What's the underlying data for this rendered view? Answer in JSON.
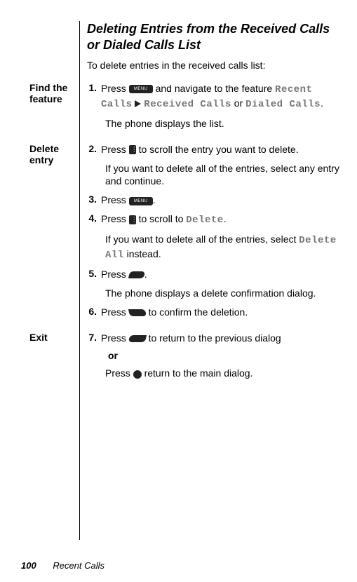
{
  "title": "Deleting Entries from the Received Calls or Dialed Calls List",
  "intro": "To delete entries in the received calls list:",
  "groups": {
    "find": {
      "label": "Find the feature",
      "step1_num": "1.",
      "step1_a": "Press ",
      "step1_b": " and navigate to the feature ",
      "code_recent": "Recent Calls",
      "code_recv": "Received Calls",
      "code_or": " or ",
      "code_dial": "Dialed Calls",
      "step1_tail": ".",
      "step1_follow": "The phone displays the list."
    },
    "del": {
      "label": "Delete entry",
      "step2_num": "2.",
      "step2_a": "Press ",
      "step2_b": " to scroll the entry you want to delete.",
      "step2_follow": "If you want to delete all of the entries, select any entry and continue.",
      "step3_num": "3.",
      "step3_a": "Press ",
      "step3_tail": ".",
      "step4_num": "4.",
      "step4_a": "Press ",
      "step4_b": " to scroll to ",
      "code_delete": "Delete",
      "step4_tail": ".",
      "step4_follow_a": "If you want to delete all of the entries, select ",
      "code_delall": "Delete All",
      "step4_follow_b": " instead.",
      "step5_num": "5.",
      "step5_a": "Press ",
      "step5_tail": ".",
      "step5_follow": "The phone displays a delete confirmation dialog.",
      "step6_num": "6.",
      "step6_a": "Press ",
      "step6_b": " to confirm the deletion."
    },
    "exit": {
      "label": "Exit",
      "step7_num": "7.",
      "step7_a": "Press ",
      "step7_b": " to return to the previous dialog",
      "or": "or",
      "step7_alt_a": "Press ",
      "step7_alt_b": " return to the main dialog."
    }
  },
  "footer": {
    "page": "100",
    "section": "Recent Calls"
  },
  "icons": {
    "menu": "MENU"
  }
}
